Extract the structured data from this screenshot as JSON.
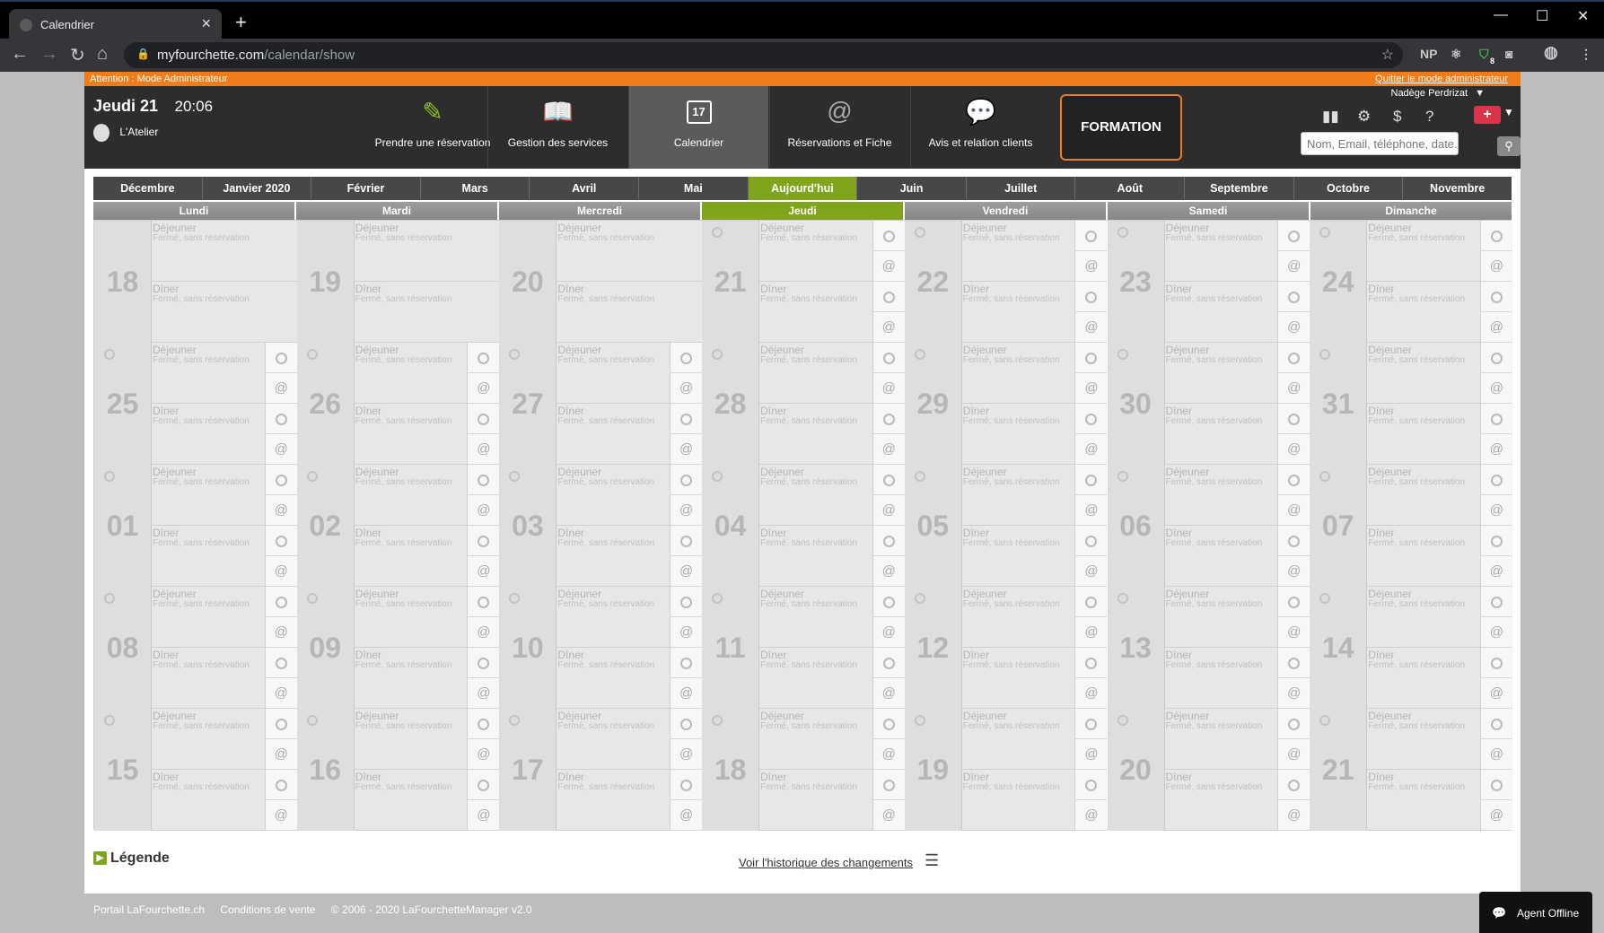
{
  "browser": {
    "tab_title": "Calendrier",
    "url_host": "myfourchette.com",
    "url_path": "/calendar/show",
    "ext_np": "NP",
    "ext_badge": "8"
  },
  "admin": {
    "warning": "Attention : Mode Administrateur",
    "quit": "Quitter le mode administrateur"
  },
  "header": {
    "day": "Jeudi 21",
    "time": "20:06",
    "restaurant": "L'Atelier",
    "user": "Nadège Perdrizat",
    "search_placeholder": "Nom, Email, téléphone, date...",
    "nav": [
      {
        "label": "Prendre une réservation",
        "icon": "edit-icon"
      },
      {
        "label": "Gestion des services",
        "icon": "book-icon"
      },
      {
        "label": "Calendrier",
        "icon": "calendar-icon",
        "icon_text": "17"
      },
      {
        "label": "Réservations et Fiche",
        "icon": "at-icon"
      },
      {
        "label": "Avis et relation clients",
        "icon": "chat-icon"
      }
    ],
    "formation": "FORMATION",
    "icons": [
      "bar-chart-icon",
      "gear-icon",
      "dollar-icon",
      "help-icon"
    ]
  },
  "months": [
    "Décembre",
    "Janvier 2020",
    "Février",
    "Mars",
    "Avril",
    "Mai",
    "Aujourd'hui",
    "Juin",
    "Juillet",
    "Août",
    "Septembre",
    "Octobre",
    "Novembre"
  ],
  "weekdays": [
    "Lundi",
    "Mardi",
    "Mercredi",
    "Jeudi",
    "Vendredi",
    "Samedi",
    "Dimanche"
  ],
  "today_weekday_index": 3,
  "service_labels": {
    "lunch": "Déjeuner",
    "dinner": "Dîner",
    "status": "Fermé, sans réservation"
  },
  "weeks": [
    [
      "18",
      "19",
      "20",
      "21",
      "22",
      "23",
      "24"
    ],
    [
      "25",
      "26",
      "27",
      "28",
      "29",
      "30",
      "31"
    ],
    [
      "01",
      "02",
      "03",
      "04",
      "05",
      "06",
      "07"
    ],
    [
      "08",
      "09",
      "10",
      "11",
      "12",
      "13",
      "14"
    ],
    [
      "15",
      "16",
      "17",
      "18",
      "19",
      "20",
      "21"
    ]
  ],
  "footer": {
    "legend": "Légende",
    "history": "Voir l'historique des changements",
    "links": [
      "Portail LaFourchette.ch",
      "Conditions de vente",
      "© 2006 - 2020 LaFourchetteManager v2.0"
    ],
    "agent": "Agent Offline"
  }
}
